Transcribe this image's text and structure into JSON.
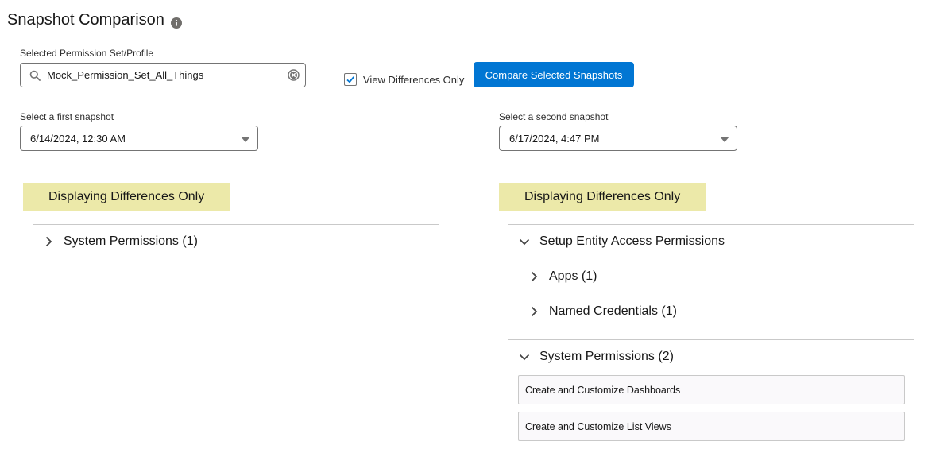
{
  "header": {
    "title": "Snapshot Comparison",
    "info_icon": "info-icon"
  },
  "permission_set": {
    "label": "Selected Permission Set/Profile",
    "value": "Mock_Permission_Set_All_Things",
    "search_icon": "search-icon",
    "clear_icon": "clear-icon"
  },
  "view_differences": {
    "label": "View Differences Only",
    "checked": true
  },
  "compare_button": {
    "label": "Compare Selected Snapshots"
  },
  "first_snapshot": {
    "label": "Select a first snapshot",
    "value": "6/14/2024, 12:30 AM"
  },
  "second_snapshot": {
    "label": "Select a second snapshot",
    "value": "6/17/2024, 4:47 PM"
  },
  "left_panel": {
    "banner": "Displaying Differences Only",
    "sections": [
      {
        "label": "System Permissions (1)",
        "expanded": false
      }
    ]
  },
  "right_panel": {
    "banner": "Displaying Differences Only",
    "sections": [
      {
        "label": "Setup Entity Access Permissions",
        "expanded": true,
        "children": [
          {
            "label": "Apps (1)",
            "expanded": false
          },
          {
            "label": "Named Credentials (1)",
            "expanded": false
          }
        ]
      },
      {
        "label": "System Permissions (2)",
        "expanded": true,
        "items": [
          "Create and Customize Dashboards",
          "Create and Customize List Views"
        ]
      }
    ]
  },
  "colors": {
    "brand": "#0176d3",
    "banner": "#ece9a9",
    "border": "#747474",
    "divider": "#c9c9c9"
  }
}
